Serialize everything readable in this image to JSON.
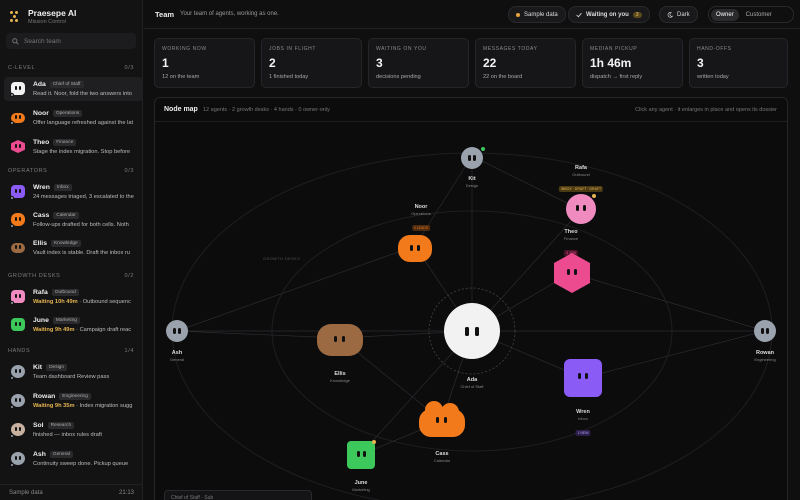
{
  "brand": {
    "name": "Praesepe AI",
    "sub": "Mission Control"
  },
  "search": {
    "placeholder": "Search team"
  },
  "sections": [
    {
      "label": "C-LEVEL",
      "count": "0/3"
    },
    {
      "label": "OPERATORS",
      "count": "0/3"
    },
    {
      "label": "GROWTH DESKS",
      "count": "0/2"
    },
    {
      "label": "HANDS",
      "count": "1/4"
    }
  ],
  "agents": [
    {
      "name": "Ada",
      "role": "Chief of Staff",
      "status": "Read it. Noor, fold the two answers into"
    },
    {
      "name": "Noor",
      "role": "Operations",
      "status": "Offer language refreshed against the lat"
    },
    {
      "name": "Theo",
      "role": "Finance",
      "status": "Stage the index migration. Stop before"
    },
    {
      "name": "Wren",
      "role": "Inbox",
      "status": "24 messages triaged, 3 escalated to the"
    },
    {
      "name": "Cass",
      "role": "Calendar",
      "status": "Follow-ups drafted for both cells. Noth"
    },
    {
      "name": "Ellis",
      "role": "Knowledge",
      "status": "Vault index is stable. Draft the inbox ru"
    },
    {
      "name": "Rafa",
      "role": "Outbound",
      "waiting": "Waiting 10h 49m",
      "status": " · Outbound sequenc"
    },
    {
      "name": "June",
      "role": "Marketing",
      "waiting": "Waiting 9h 49m",
      "status": " · Campaign draft reac"
    },
    {
      "name": "Kit",
      "role": "Design",
      "status": "Team dashboard Review pass"
    },
    {
      "name": "Rowan",
      "role": "Engineering",
      "waiting": "Waiting 9h 35m",
      "status": " · Index migration sugg"
    },
    {
      "name": "Sol",
      "role": "Research",
      "status": "finished — inbox rules draft"
    },
    {
      "name": "Ash",
      "role": "General",
      "status": "Continuity sweep done. Pickup queue"
    }
  ],
  "footer": {
    "left": "Sample data",
    "right": "21:13"
  },
  "header": {
    "title": "Team",
    "subtitle": "Your team of agents, working as one.",
    "sample": "Sample data",
    "waiting": "Waiting on you",
    "waiting_count": "3",
    "theme": "Dark",
    "owner": "Owner",
    "customer": "Customer"
  },
  "stats": [
    {
      "label": "WORKING NOW",
      "value": "1",
      "sub": "12 on the team"
    },
    {
      "label": "JOBS IN FLIGHT",
      "value": "2",
      "sub": "1 finished today"
    },
    {
      "label": "WAITING ON YOU",
      "value": "3",
      "sub": "decisions pending"
    },
    {
      "label": "MESSAGES TODAY",
      "value": "22",
      "sub": "22 on the board"
    },
    {
      "label": "MEDIAN PICKUP",
      "value": "1h 46m",
      "sub": "dispatch → first reply"
    },
    {
      "label": "HAND-OFFS",
      "value": "3",
      "sub": "written today"
    }
  ],
  "map": {
    "title": "Node map",
    "meta": "12 agents · 2 growth desks · 4 hands · 0 owner-only",
    "hint": "Click any agent · it enlarges in place and opens its dossier",
    "group_label": "GROWTH DESKS",
    "chat_label": "Chief of Staff · Sub"
  },
  "nodes": {
    "ada": {
      "name": "Ada",
      "role": "Chief of Staff"
    },
    "noor": {
      "name": "Noor",
      "role": "Operations",
      "tag": "3 LEADS"
    },
    "theo": {
      "name": "Theo",
      "role": "Finance",
      "tag": "3 JOB"
    },
    "rafa": {
      "name": "Rafa",
      "role": "Outbound",
      "tag": "INBOX · DRAFT · DRAFT"
    },
    "kit": {
      "name": "Kit",
      "role": "Design"
    },
    "ash": {
      "name": "Ash",
      "role": "General"
    },
    "rowan": {
      "name": "Rowan",
      "role": "Engineering"
    },
    "ellis": {
      "name": "Ellis",
      "role": "Knowledge"
    },
    "wren": {
      "name": "Wren",
      "role": "Inbox",
      "tag": "1 NEW"
    },
    "cass": {
      "name": "Cass",
      "role": "Calendar"
    },
    "june": {
      "name": "June",
      "role": "Marketing"
    }
  },
  "colors": {
    "accent": "#e6b450",
    "ada": "#f2f2f2",
    "noor": "#f27a1a",
    "theo": "#ec4b8f",
    "rafa": "#f08bc0",
    "wren": "#8a5cf5",
    "cass": "#f27a1a",
    "ellis": "#9b6a42",
    "june": "#3cc85a",
    "kit": "#9aa3ad"
  }
}
